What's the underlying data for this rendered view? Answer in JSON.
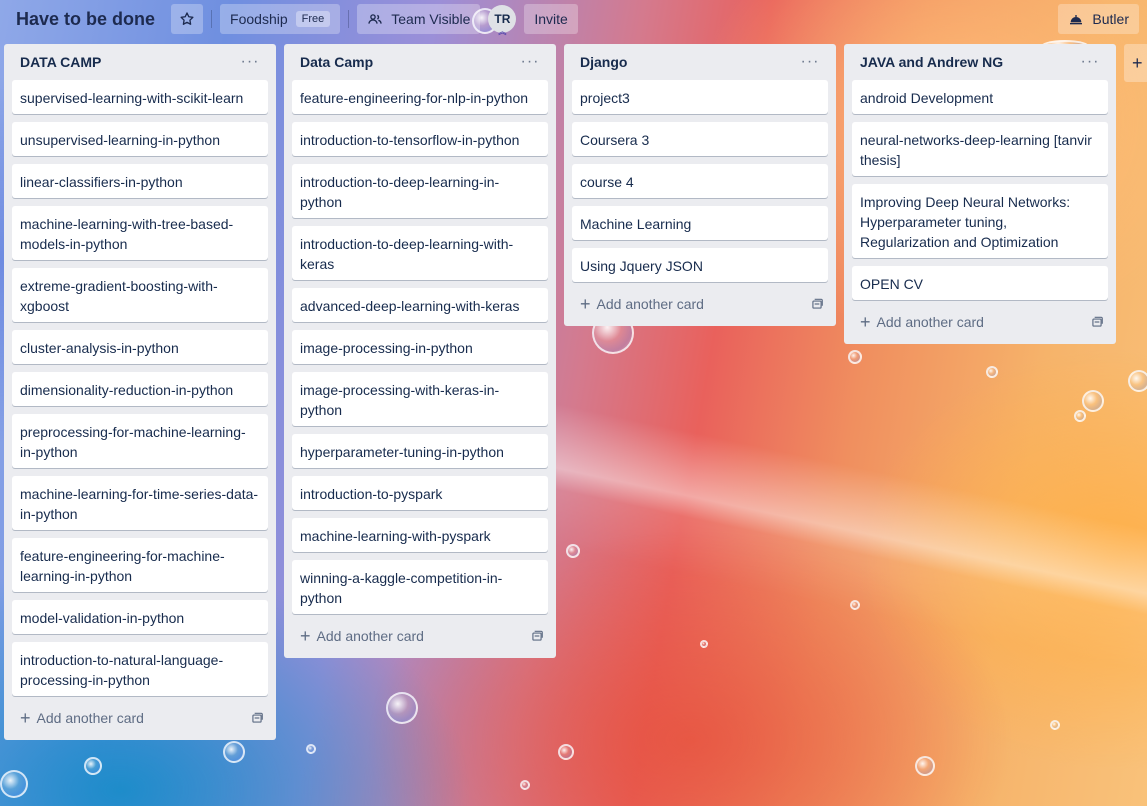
{
  "header": {
    "board_title": "Have to be done",
    "workspace_label": "Foodship",
    "workspace_badge": "Free",
    "visibility_label": "Team Visible",
    "avatar_initials": "TR",
    "invite_label": "Invite",
    "butler_label": "Butler"
  },
  "lists": [
    {
      "title": "DATA CAMP",
      "cards": [
        "supervised-learning-with-scikit-learn",
        "unsupervised-learning-in-python",
        "linear-classifiers-in-python",
        "machine-learning-with-tree-based-models-in-python",
        "extreme-gradient-boosting-with-xgboost",
        "cluster-analysis-in-python",
        "dimensionality-reduction-in-python",
        "preprocessing-for-machine-learning-in-python",
        "machine-learning-for-time-series-data-in-python",
        "feature-engineering-for-machine-learning-in-python",
        "model-validation-in-python",
        "introduction-to-natural-language-processing-in-python"
      ],
      "add_label": "Add another card"
    },
    {
      "title": "Data Camp",
      "cards": [
        "feature-engineering-for-nlp-in-python",
        "introduction-to-tensorflow-in-python",
        "introduction-to-deep-learning-in-python",
        "introduction-to-deep-learning-with-keras",
        "advanced-deep-learning-with-keras",
        "image-processing-in-python",
        "image-processing-with-keras-in-python",
        "hyperparameter-tuning-in-python",
        "introduction-to-pyspark",
        "machine-learning-with-pyspark",
        "winning-a-kaggle-competition-in-python"
      ],
      "add_label": "Add another card"
    },
    {
      "title": "Django",
      "cards": [
        "project3",
        "Coursera 3",
        "course 4",
        "Machine Learning",
        "Using Jquery JSON"
      ],
      "add_label": "Add another card"
    },
    {
      "title": "JAVA and Andrew NG",
      "cards": [
        "android Development",
        "neural-networks-deep-learning [tanvir thesis]",
        "Improving Deep Neural Networks: Hyperparameter tuning, Regularization and Optimization",
        "OPEN CV"
      ],
      "add_label": "Add another card"
    }
  ],
  "icons": {
    "star": "star-icon",
    "visibility": "team-icon",
    "butler": "butler-icon",
    "list_menu": "more-icon",
    "add": "plus-icon",
    "template": "card-template-icon"
  },
  "colors": {
    "list_bg": "#ebecf0",
    "card_bg": "#ffffff",
    "text": "#172b4d",
    "muted": "#5e6c84",
    "header_text": "#1d2a4f"
  }
}
